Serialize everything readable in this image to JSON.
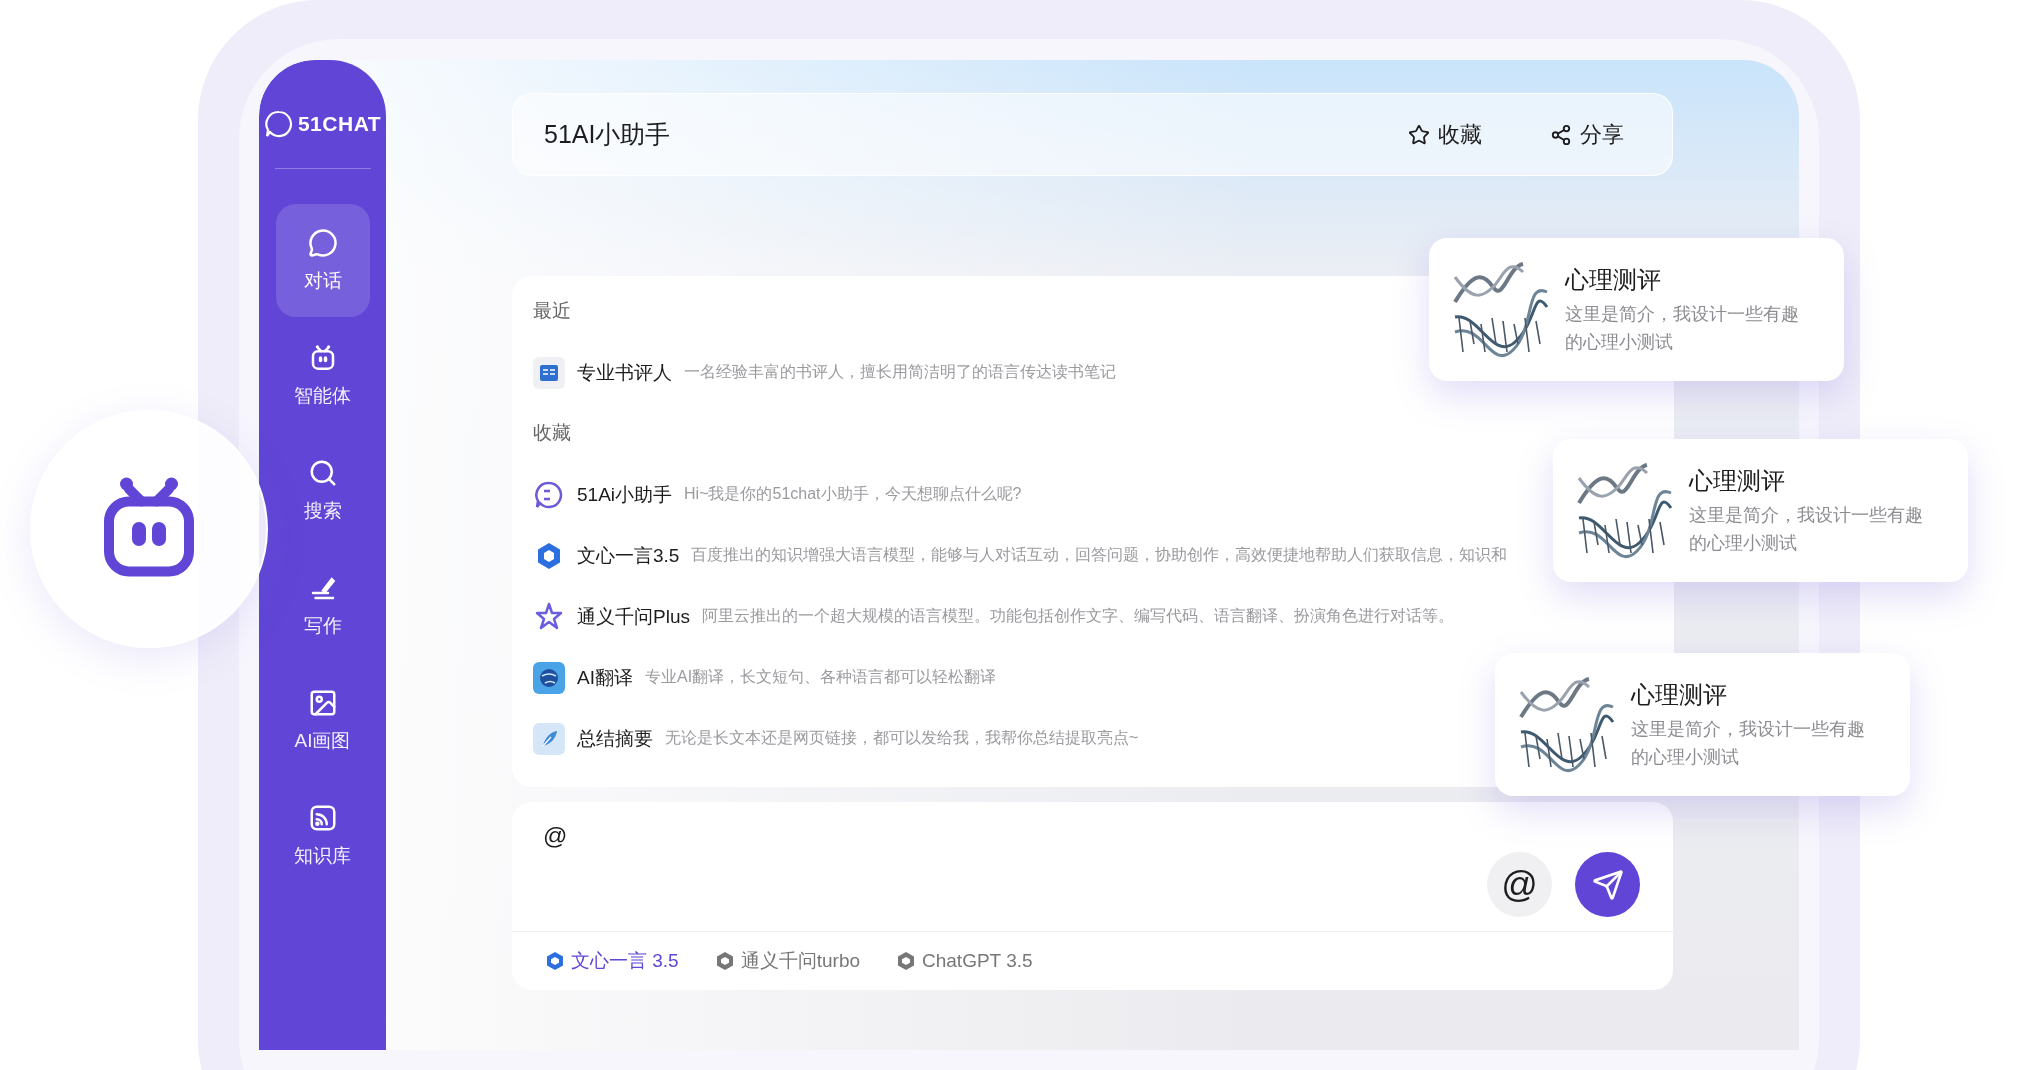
{
  "sidebar": {
    "logo": "51CHAT",
    "items": [
      {
        "label": "对话",
        "selected": true
      },
      {
        "label": "智能体",
        "selected": false
      },
      {
        "label": "搜索",
        "selected": false
      },
      {
        "label": "写作",
        "selected": false
      },
      {
        "label": "AI画图",
        "selected": false
      },
      {
        "label": "知识库",
        "selected": false
      }
    ]
  },
  "header": {
    "title": "51AI小助手",
    "actions": [
      "收藏",
      "分享"
    ]
  },
  "list": {
    "sections": [
      {
        "title": "最近",
        "items": [
          {
            "name": "专业书评人",
            "desc": "一名经验丰富的书评人，擅长用简洁明了的语言传达读书笔记"
          }
        ]
      },
      {
        "title": "收藏",
        "items": [
          {
            "name": "51Ai小助手",
            "desc": "Hi~我是你的51chat小助手，今天想聊点什么呢?"
          },
          {
            "name": "文心一言3.5",
            "desc": "百度推出的知识增强大语言模型，能够与人对话互动，回答问题，协助创作，高效便捷地帮助人们获取信息，知识和"
          },
          {
            "name": "通义千问Plus",
            "desc": "阿里云推出的一个超大规模的语言模型。功能包括创作文字、编写代码、语言翻译、扮演角色进行对话等。"
          },
          {
            "name": "AI翻译",
            "desc": "专业AI翻译，长文短句、各种语言都可以轻松翻译"
          },
          {
            "name": "总结摘要",
            "desc": "无论是长文本还是网页链接，都可以发给我，我帮你总结提取亮点~"
          }
        ]
      }
    ]
  },
  "input": {
    "value": "@",
    "at_button": "@"
  },
  "models": [
    {
      "label": "文心一言 3.5",
      "selected": true
    },
    {
      "label": "通义千问turbo",
      "selected": false
    },
    {
      "label": "ChatGPT 3.5",
      "selected": false
    }
  ],
  "cards": [
    {
      "title": "心理测评",
      "desc": "这里是简介，我设计一些有趣的心理小测试"
    },
    {
      "title": "心理测评",
      "desc": "这里是简介，我设计一些有趣的心理小测试"
    },
    {
      "title": "心理测评",
      "desc": "这里是简介，我设计一些有趣的心理小测试"
    }
  ]
}
